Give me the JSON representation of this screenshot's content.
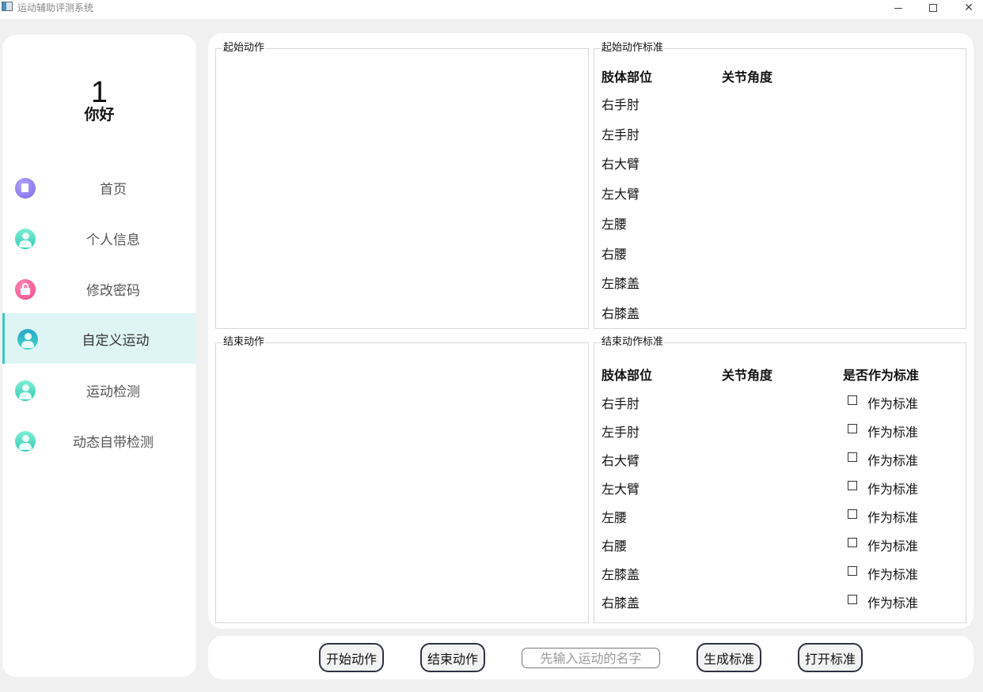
{
  "window": {
    "title": "运动辅助评测系统",
    "controls": [
      "minimize",
      "maximize",
      "close"
    ]
  },
  "sidebar": {
    "user_number": "1",
    "greeting": "你好",
    "active_index": 3,
    "items": [
      {
        "label": "首页",
        "icon": "document-icon"
      },
      {
        "label": "个人信息",
        "icon": "user-icon"
      },
      {
        "label": "修改密码",
        "icon": "lock-icon"
      },
      {
        "label": "自定义运动",
        "icon": "user-icon"
      },
      {
        "label": "运动检测",
        "icon": "user-icon"
      },
      {
        "label": "动态自带检测",
        "icon": "user-icon"
      }
    ]
  },
  "main": {
    "start_action": {
      "title": "起始动作"
    },
    "start_standard": {
      "title": "起始动作标准",
      "headers": {
        "part": "肢体部位",
        "angle": "关节角度"
      },
      "rows": [
        "右手肘",
        "左手肘",
        "右大臂",
        "左大臂",
        "左腰",
        "右腰",
        "左膝盖",
        "右膝盖"
      ]
    },
    "end_action": {
      "title": "结束动作"
    },
    "end_standard": {
      "title": "结束动作标准",
      "headers": {
        "part": "肢体部位",
        "angle": "关节角度",
        "as_standard": "是否作为标准"
      },
      "rows": [
        "右手肘",
        "左手肘",
        "右大臂",
        "左大臂",
        "左腰",
        "右腰",
        "左膝盖",
        "右膝盖"
      ],
      "checkbox_label": "作为标准"
    }
  },
  "toolbar": {
    "start_button": "开始动作",
    "end_button": "结束动作",
    "name_placeholder": "先输入运动的名字",
    "generate_button": "生成标准",
    "open_button": "打开标准"
  },
  "colors": {
    "accent": "#3cc9c0",
    "active_bg": "#dff5f5",
    "button_border": "#2e3140"
  }
}
